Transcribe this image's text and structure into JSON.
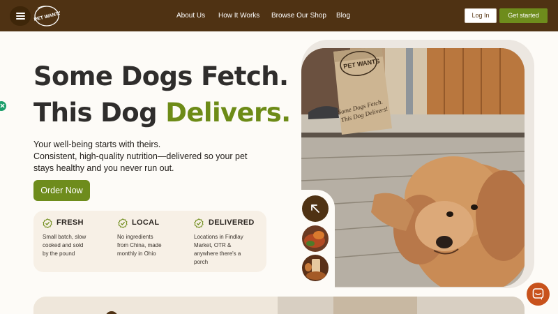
{
  "header": {
    "logo_text": "PET WANTS",
    "nav": [
      "About Us",
      "How It Works",
      "Browse Our Shop",
      "Blog"
    ],
    "login_label": "Log In",
    "get_started_label": "Get started"
  },
  "hero": {
    "headline_line1": "Some Dogs Fetch.",
    "headline_line2_prefix": "This Dog ",
    "headline_line2_accent": "Delivers.",
    "subtext_line1": "Your well-being starts with theirs.",
    "subtext_line2": "Consistent, high-quality nutrition—delivered so your pet",
    "subtext_line3": "stays healthy and you never run out.",
    "cta_label": "Order Now"
  },
  "features": [
    {
      "title": "FRESH",
      "desc": [
        "Small batch, slow",
        "cooked and sold",
        "by the pound"
      ]
    },
    {
      "title": "LOCAL",
      "desc": [
        "No ingredients",
        "from China, made",
        "monthly in Ohio"
      ]
    },
    {
      "title": "DELIVERED",
      "desc": [
        "Locations in Findlay",
        "Market, OTR &",
        "anywhere there's a",
        "porch"
      ]
    }
  ],
  "photo": {
    "bag_brand": "PET WANTS",
    "bag_text1": "Some Dogs Fetch.",
    "bag_text2": "This Dog Delivers!"
  },
  "colors": {
    "header_bg": "#4f3213",
    "accent_green": "#6d8b17",
    "chat_orange": "#c8521c"
  },
  "icons": [
    "menu-icon",
    "arrow-up-left-icon",
    "check-badge-icon",
    "chat-icon",
    "close-icon"
  ]
}
